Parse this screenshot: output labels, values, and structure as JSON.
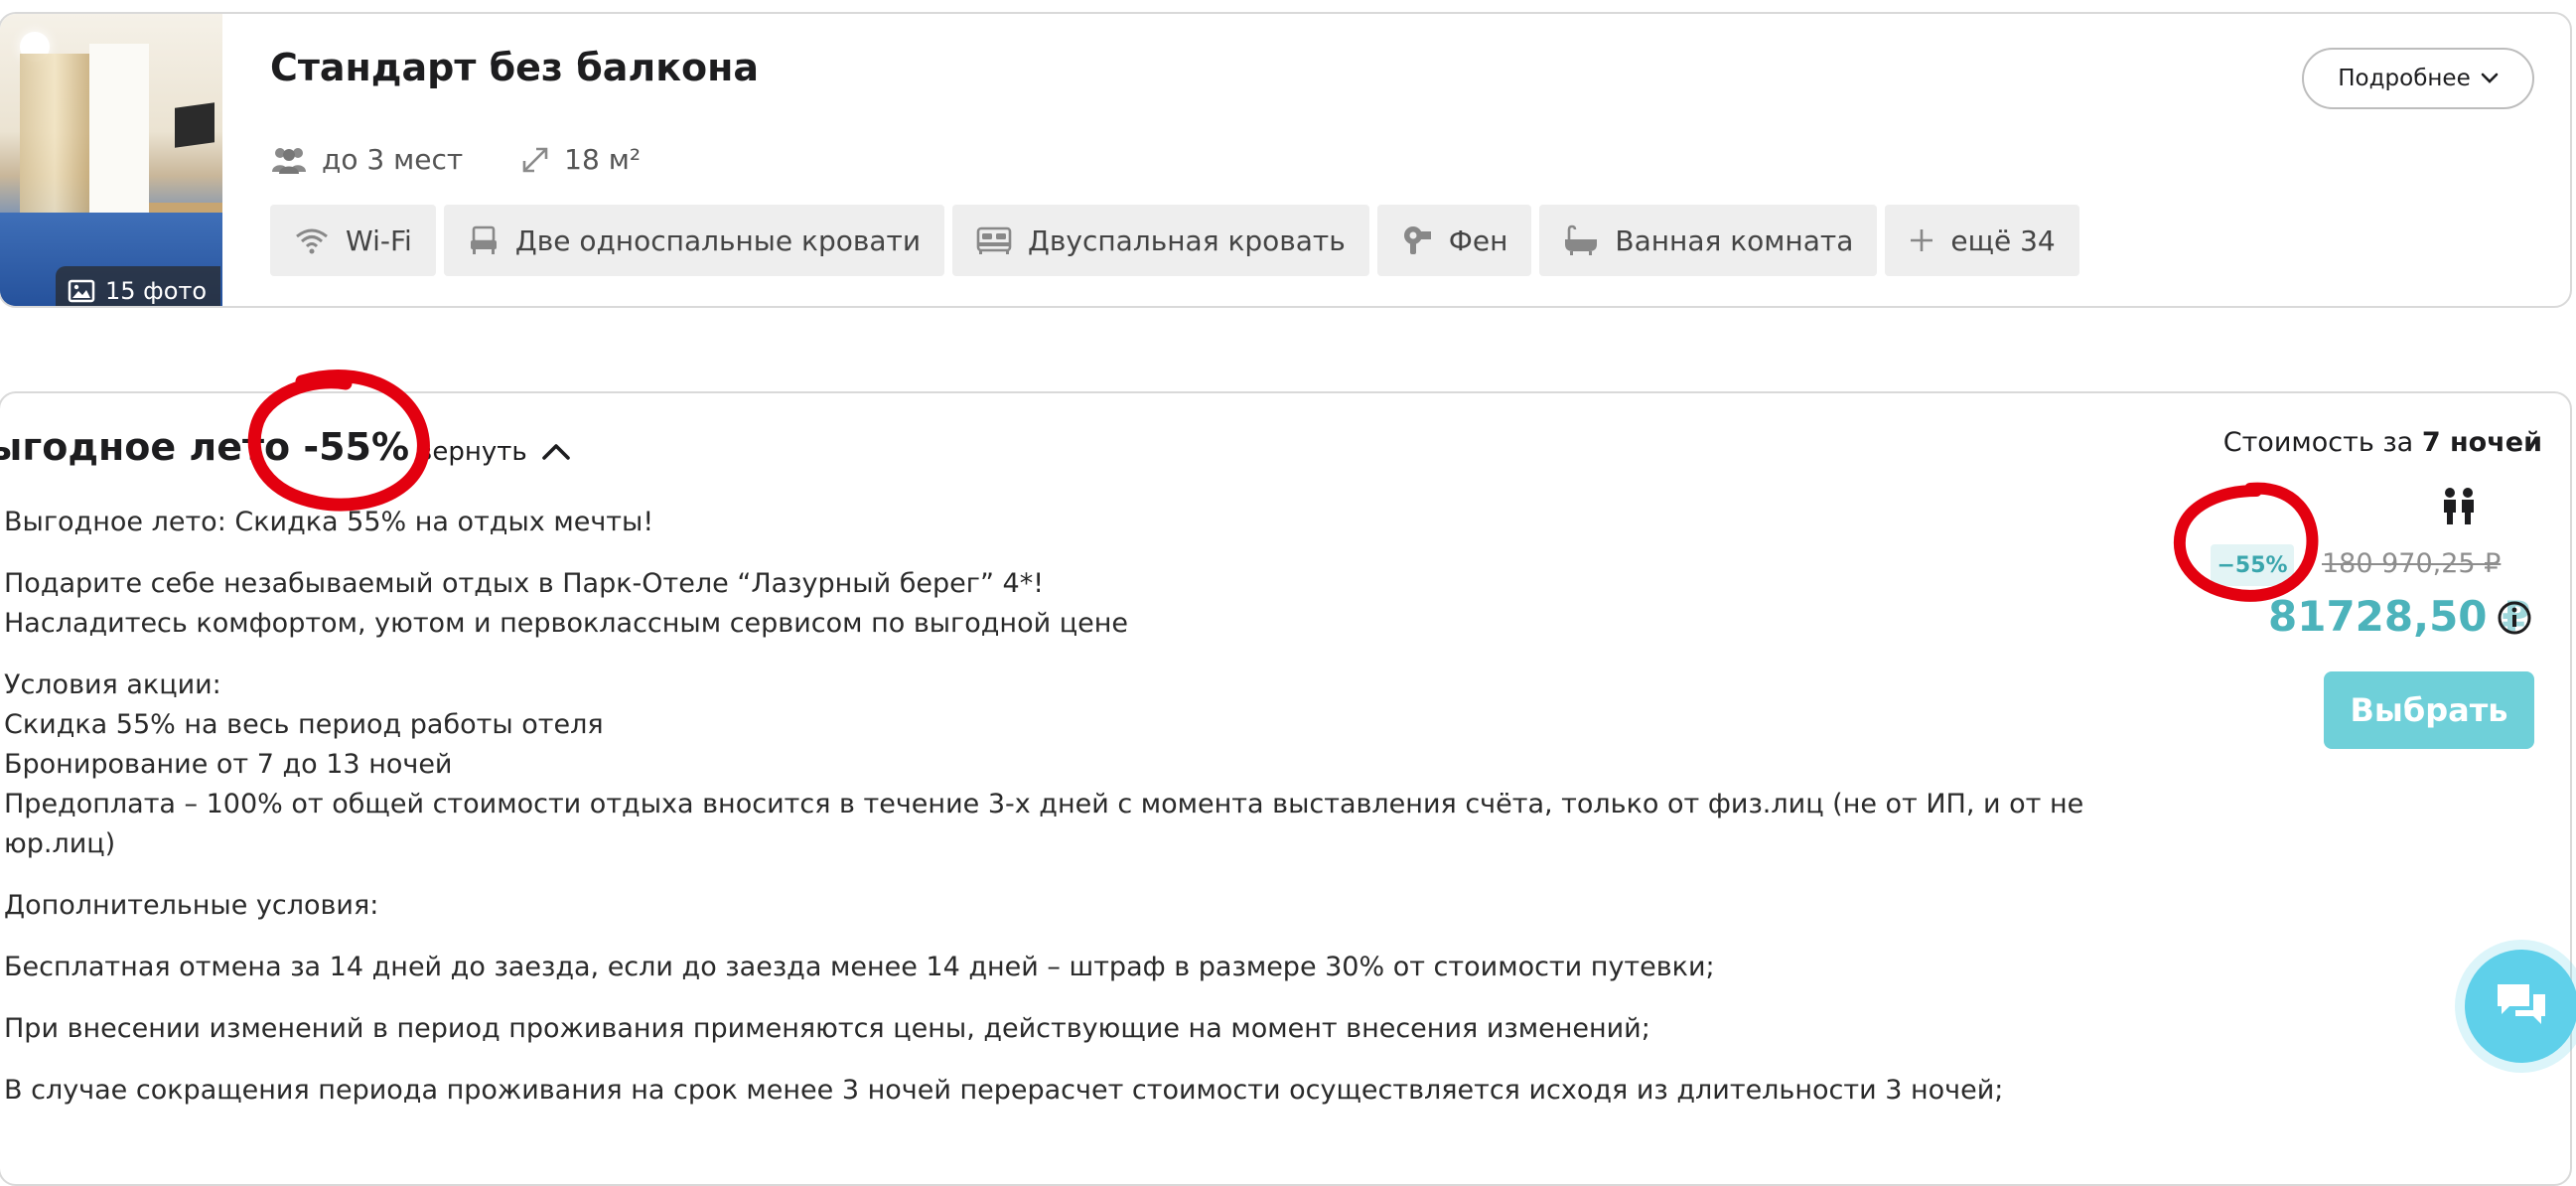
{
  "room": {
    "title": "Стандарт без балкона",
    "photos_label": "15 фото",
    "more_button": "Подробнее",
    "capacity": "до 3 мест",
    "area": "18 м²",
    "amenities": [
      {
        "icon": "wifi-icon",
        "label": "Wi-Fi"
      },
      {
        "icon": "single-beds-icon",
        "label": "Две односпальные кровати"
      },
      {
        "icon": "double-bed-icon",
        "label": "Двуспальная кровать"
      },
      {
        "icon": "hairdryer-icon",
        "label": "Фен"
      },
      {
        "icon": "bathtub-icon",
        "label": "Ванная комната"
      },
      {
        "icon": "plus-icon",
        "label": "ещё 34"
      }
    ]
  },
  "tariff": {
    "title": "ыгодное лето -55%",
    "collapse_label": "вернуть",
    "description": {
      "intro": "Выгодное лето: Скидка 55% на отдых мечты!",
      "gift_line1": "Подарите себе незабываемый отдых в Парк-Отеле “Лазурный берег” 4*!",
      "gift_line2": "Насладитесь комфортом, уютом и первоклассным сервисом по выгодной цене",
      "conditions_title": "Условия акции:",
      "condition1": "Скидка 55% на весь период работы отеля",
      "condition2": "Бронирование от 7 до 13 ночей",
      "condition3": "Предоплата – 100% от общей стоимости отдыха вносится в течение 3-х дней с момента выставления счёта, только от физ.лиц (не от ИП, и от не",
      "condition3b": "юр.лиц)",
      "extra_title": "Дополнительные условия:",
      "extra1": "Бесплатная отмена за 14 дней до заезда, если до заезда менее 14 дней – штраф в размере 30% от стоимости путевки;",
      "extra2": "При внесении изменений в период проживания применяются цены, действующие на момент внесения изменений;",
      "extra3": "В случае сокращения периода проживания на срок менее 3 ночей перерасчет стоимости осуществляется исходя из длительности 3 ночей;"
    },
    "cost_prefix": "Стоимость за",
    "cost_nights": "7 ночей",
    "discount_badge": "−55%",
    "old_price": "180 970,25 ₽",
    "new_price": "81728,50",
    "currency": "₽",
    "select_button": "Выбрать"
  },
  "colors": {
    "accent": "#4cb3bb",
    "button": "#6fd0d9",
    "chat": "#5fd0ea",
    "annotation": "#e3000f"
  }
}
